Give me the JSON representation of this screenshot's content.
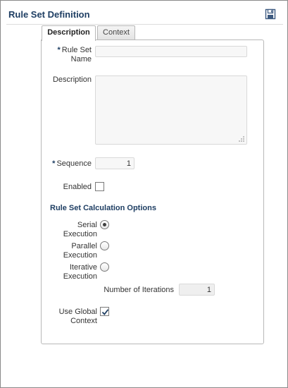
{
  "header": {
    "title": "Rule Set Definition",
    "save_icon": "save-icon"
  },
  "tabs": [
    {
      "label": "Description",
      "selected": true
    },
    {
      "label": "Context",
      "selected": false
    }
  ],
  "form": {
    "required_marker": "*",
    "rule_set_name": {
      "label_line1": "Rule Set",
      "label_line2": "Name",
      "value": ""
    },
    "description": {
      "label": "Description",
      "value": ""
    },
    "sequence": {
      "label": "Sequence",
      "value": "1"
    },
    "enabled": {
      "label": "Enabled",
      "checked": false
    }
  },
  "calculation_options": {
    "title": "Rule Set Calculation Options",
    "serial": {
      "label_line1": "Serial",
      "label_line2": "Execution",
      "selected": true
    },
    "parallel": {
      "label_line1": "Parallel",
      "label_line2": "Execution",
      "selected": false
    },
    "iterative": {
      "label_line1": "Iterative",
      "label_line2": "Execution",
      "selected": false
    },
    "iterations": {
      "label": "Number of Iterations",
      "value": "1"
    },
    "use_global_context": {
      "label_line1": "Use Global",
      "label_line2": "Context",
      "checked": true
    }
  },
  "colors": {
    "title": "#1e3e63",
    "border": "#b8b8b8",
    "field_bg": "#f7f7f7"
  }
}
